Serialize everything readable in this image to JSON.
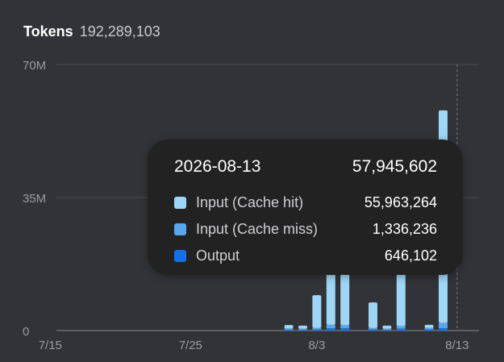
{
  "header": {
    "label": "Tokens",
    "total": "192,289,103"
  },
  "colors": {
    "cache_hit": "#9dd6f6",
    "cache_miss": "#57a6ee",
    "output": "#1470e8",
    "grid": "#4a4b4f",
    "axis_text": "#9b9ca0"
  },
  "tooltip": {
    "date": "2026-08-13",
    "total": "57,945,602",
    "rows": [
      {
        "name": "Input (Cache hit)",
        "value": "55,963,264",
        "color": "#9dd6f6"
      },
      {
        "name": "Input (Cache miss)",
        "value": "1,336,236",
        "color": "#57a6ee"
      },
      {
        "name": "Output",
        "value": "646,102",
        "color": "#1470e8"
      }
    ]
  },
  "chart_data": {
    "type": "bar",
    "stacked": true,
    "ylim": [
      0,
      70000000
    ],
    "y_ticks": [
      {
        "value": 0,
        "label": "0"
      },
      {
        "value": 35000000,
        "label": "35M"
      },
      {
        "value": 70000000,
        "label": "70M"
      }
    ],
    "x_ticks": [
      {
        "date": "2026-07-15",
        "label": "7/15"
      },
      {
        "date": "2026-07-25",
        "label": "7/25"
      },
      {
        "date": "2026-08-03",
        "label": "8/3"
      },
      {
        "date": "2026-08-13",
        "label": "8/13"
      }
    ],
    "grid": true,
    "categories": [
      "2026-07-13",
      "2026-07-14",
      "2026-07-15",
      "2026-07-16",
      "2026-07-17",
      "2026-07-18",
      "2026-07-19",
      "2026-07-20",
      "2026-07-21",
      "2026-07-22",
      "2026-07-23",
      "2026-07-24",
      "2026-07-25",
      "2026-07-26",
      "2026-07-27",
      "2026-07-28",
      "2026-07-29",
      "2026-07-30",
      "2026-07-31",
      "2026-08-01",
      "2026-08-02",
      "2026-08-03",
      "2026-08-04",
      "2026-08-05",
      "2026-08-06",
      "2026-08-07",
      "2026-08-08",
      "2026-08-09",
      "2026-08-10",
      "2026-08-11",
      "2026-08-12",
      "2026-08-13"
    ],
    "series": [
      {
        "name": "Input (Cache hit)",
        "color": "#9dd6f6",
        "values": [
          0,
          0,
          0,
          0,
          0,
          0,
          0,
          0,
          0,
          0,
          0,
          0,
          0,
          0,
          0,
          0,
          0,
          0,
          0,
          0.9,
          0.8,
          8.6,
          14,
          16,
          0,
          6.7,
          0.8,
          14,
          0,
          0.8,
          55.963264
        ]
      },
      {
        "name": "Input (Cache miss)",
        "color": "#57a6ee",
        "values": [
          0,
          0,
          0,
          0,
          0,
          0,
          0,
          0,
          0,
          0,
          0,
          0,
          0,
          0,
          0,
          0,
          0,
          0,
          0,
          0.35,
          0.3,
          0.4,
          0.9,
          0.8,
          0,
          0.4,
          0.3,
          0.7,
          0,
          0.4,
          1.336236
        ]
      },
      {
        "name": "Output",
        "color": "#1470e8",
        "values": [
          0,
          0,
          0,
          0,
          0,
          0,
          0,
          0,
          0,
          0,
          0,
          0,
          0,
          0,
          0,
          0,
          0,
          0,
          0,
          0.2,
          0.2,
          0.3,
          0.6,
          0.6,
          0,
          0.3,
          0.2,
          0.5,
          0,
          0.3,
          0.646102
        ]
      }
    ],
    "value_unit": "millions of tokens",
    "hover_category": "2026-08-13"
  }
}
